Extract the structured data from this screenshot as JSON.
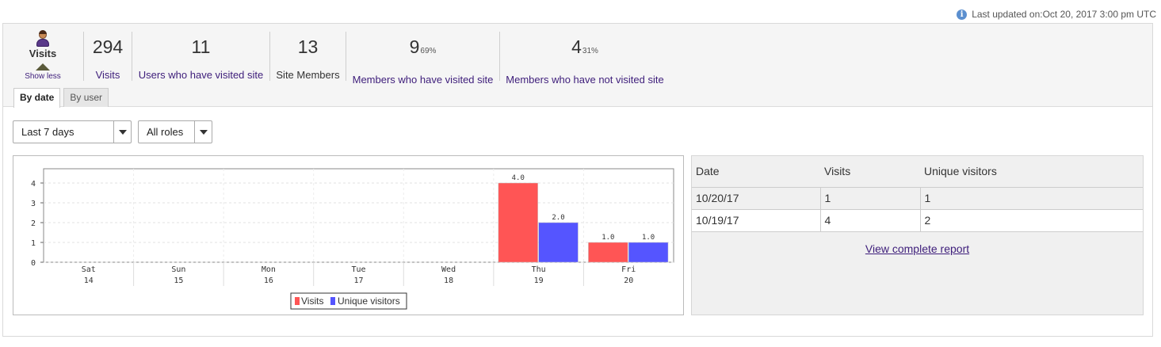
{
  "updated": {
    "text": "Last updated on:Oct 20, 2017 3:00 pm UTC"
  },
  "summary": {
    "title": "Visits",
    "show_less": "Show less",
    "stats": [
      {
        "value": "294",
        "pct": "",
        "label": "Visits"
      },
      {
        "value": "11",
        "pct": "",
        "label": "Users who have visited site"
      },
      {
        "value": "13",
        "pct": "",
        "label": "Site Members"
      },
      {
        "value": "9",
        "pct": "69%",
        "label": "Members who have visited site"
      },
      {
        "value": "4",
        "pct": "31%",
        "label": "Members who have not visited site"
      }
    ]
  },
  "tabs": [
    {
      "label": "By date",
      "active": true
    },
    {
      "label": "By user",
      "active": false
    }
  ],
  "filters": {
    "range": "Last 7 days",
    "roles": "All roles"
  },
  "colors": {
    "visits": "#ff5555",
    "unique": "#5555ff",
    "link": "#3d1d7a"
  },
  "chart_data": {
    "type": "bar",
    "categories": [
      "Sat 14",
      "Sun 15",
      "Mon 16",
      "Tue 17",
      "Wed 18",
      "Thu 19",
      "Fri 20"
    ],
    "x_days": [
      "Sat",
      "Sun",
      "Mon",
      "Tue",
      "Wed",
      "Thu",
      "Fri"
    ],
    "x_dates": [
      "14",
      "15",
      "16",
      "17",
      "18",
      "19",
      "20"
    ],
    "series": [
      {
        "name": "Visits",
        "values": [
          0,
          0,
          0,
          0,
          0,
          4.0,
          1.0
        ],
        "labels": [
          "",
          "",
          "",
          "",
          "",
          "4.0",
          "1.0"
        ]
      },
      {
        "name": "Unique visitors",
        "values": [
          0,
          0,
          0,
          0,
          0,
          2.0,
          1.0
        ],
        "labels": [
          "",
          "",
          "",
          "",
          "",
          "2.0",
          "1.0"
        ]
      }
    ],
    "ylim": [
      0,
      4.72
    ],
    "yticks": [
      0,
      1,
      2,
      3,
      4
    ],
    "grid": true,
    "legend": "bottom-center"
  },
  "table": {
    "headers": [
      "Date",
      "Visits",
      "Unique visitors"
    ],
    "rows": [
      [
        "10/20/17",
        "1",
        "1"
      ],
      [
        "10/19/17",
        "4",
        "2"
      ]
    ],
    "link": "View complete report"
  }
}
